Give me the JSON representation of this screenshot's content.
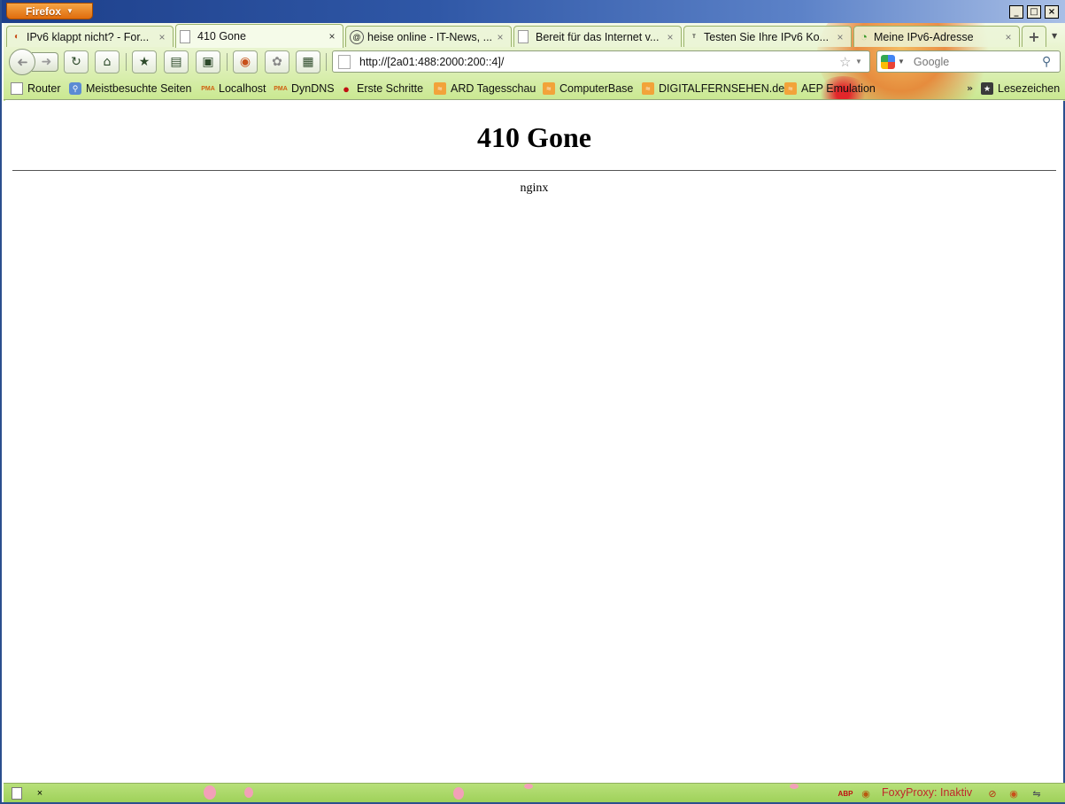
{
  "app": {
    "menu_label": "Firefox"
  },
  "window_controls": {
    "minimize": "_",
    "maximize": "□",
    "close": "×"
  },
  "tabs": [
    {
      "title": "IPv6 klappt nicht? - For...",
      "icon": "forum-icon",
      "active": false
    },
    {
      "title": "410 Gone",
      "icon": "page-icon",
      "active": true
    },
    {
      "title": "heise online - IT-News, ...",
      "icon": "heise-icon",
      "active": false
    },
    {
      "title": "Bereit für das Internet v...",
      "icon": "page-icon",
      "active": false
    },
    {
      "title": "Testen Sie Ihre IPv6 Ko...",
      "icon": "test-ipv6-icon",
      "active": false
    },
    {
      "title": "Meine IPv6-Adresse",
      "icon": "loading-icon",
      "active": false
    }
  ],
  "new_tab_label": "+",
  "navigation": {
    "url": "http://[2a01:488:2000:200::4]/",
    "search_placeholder": "Google",
    "search_engine": "google-icon"
  },
  "bookmarks": [
    {
      "label": "Router",
      "icon": "page-icon"
    },
    {
      "label": "Meistbesuchte Seiten",
      "icon": "smart-folder-icon"
    },
    {
      "label": "Localhost",
      "icon": "phpmyadmin-icon"
    },
    {
      "label": "DynDNS",
      "icon": "phpmyadmin-icon"
    },
    {
      "label": "Erste Schritte",
      "icon": "firefox-icon"
    },
    {
      "label": "ARD Tagesschau",
      "icon": "rss-icon"
    },
    {
      "label": "ComputerBase",
      "icon": "rss-icon"
    },
    {
      "label": "DIGITALFERNSEHEN.de",
      "icon": "rss-icon"
    },
    {
      "label": "AEP Emulation",
      "icon": "rss-icon"
    }
  ],
  "bookmarks_overflow": "»",
  "bookmarks_menu_label": "Lesezeichen",
  "page": {
    "heading": "410 Gone",
    "server": "nginx"
  },
  "statusbar": {
    "close_label": "×",
    "foxyproxy_status": "FoxyProxy: Inaktiv"
  },
  "colors": {
    "titlebar": "#2f57a6",
    "app_button": "#e57a1a",
    "persona_green": "#c9e88f",
    "foxyproxy_text": "#c0262a"
  }
}
